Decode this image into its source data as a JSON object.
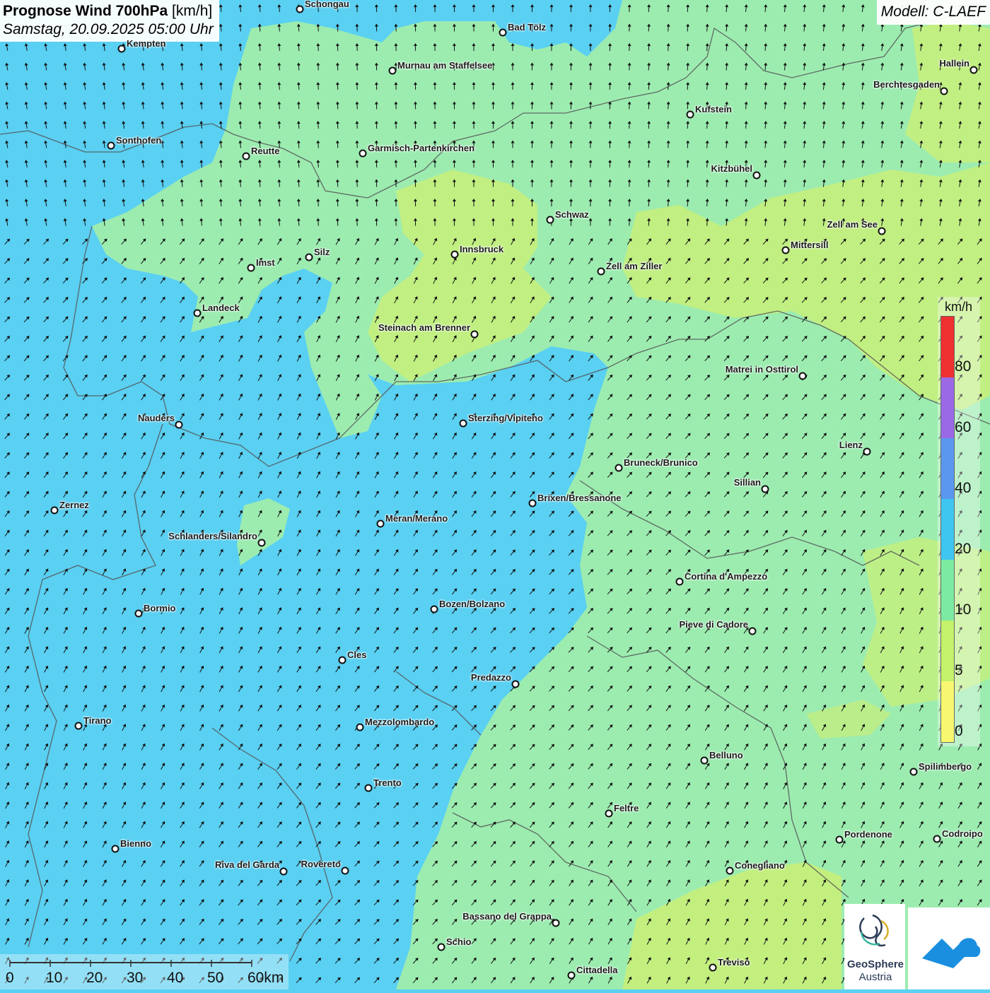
{
  "title": {
    "bold": "Prognose Wind 700hPa",
    "unit": "[km/h]",
    "datetime": "Samstag, 20.09.2025 05:00 Uhr"
  },
  "model": "Modell: C-LAEF",
  "legend": {
    "unit": "km/h",
    "ticks": [
      "80",
      "60",
      "40",
      "20",
      "10",
      "5",
      "0"
    ],
    "colors": [
      "#ee3030",
      "#9a6ae6",
      "#5a98ef",
      "#3ec6f0",
      "#7deaa2",
      "#c4f26a",
      "#f8f870"
    ]
  },
  "scale": {
    "labels": [
      "0",
      "10",
      "20",
      "30",
      "40",
      "50",
      "60km"
    ]
  },
  "logo": {
    "name": "GeoSphere",
    "subtitle": "Austria"
  },
  "map_colors": {
    "strong_20_40": "#5ad0f2",
    "mid_10_20": "#9cecb0",
    "weak_5_10": "#c8f07a",
    "border": "#555555"
  },
  "cities": [
    {
      "name": "Schongau"
    },
    {
      "name": "Bad Tölz"
    },
    {
      "name": "Kempten"
    },
    {
      "name": "Murnau am Staffelsee"
    },
    {
      "name": "Hallein"
    },
    {
      "name": "Berchtesgaden"
    },
    {
      "name": "Kufstein"
    },
    {
      "name": "Sonthofen"
    },
    {
      "name": "Reutte"
    },
    {
      "name": "Garmisch-Partenkirchen"
    },
    {
      "name": "Kitzbühel"
    },
    {
      "name": "Schwaz"
    },
    {
      "name": "Zell am See"
    },
    {
      "name": "Mittersill"
    },
    {
      "name": "Innsbruck"
    },
    {
      "name": "Silz"
    },
    {
      "name": "Imst"
    },
    {
      "name": "Zell am Ziller"
    },
    {
      "name": "Landeck"
    },
    {
      "name": "Steinach am Brenner"
    },
    {
      "name": "Matrei in Osttirol"
    },
    {
      "name": "Nauders"
    },
    {
      "name": "Sterzing/Vipiteno"
    },
    {
      "name": "Lienz"
    },
    {
      "name": "Bruneck/Brunico"
    },
    {
      "name": "Sillian"
    },
    {
      "name": "Brixen/Bressanone"
    },
    {
      "name": "Zernez"
    },
    {
      "name": "Meran/Merano"
    },
    {
      "name": "Schlanders/Silandro"
    },
    {
      "name": "Cortina d'Ampezzo"
    },
    {
      "name": "Bozen/Bolzano"
    },
    {
      "name": "Bormio"
    },
    {
      "name": "Pieve di Cadore"
    },
    {
      "name": "Cles"
    },
    {
      "name": "Predazzo"
    },
    {
      "name": "Tirano"
    },
    {
      "name": "Mezzolombardo"
    },
    {
      "name": "Belluno"
    },
    {
      "name": "Spilimbergo"
    },
    {
      "name": "Trento"
    },
    {
      "name": "Feltre"
    },
    {
      "name": "Pordenone"
    },
    {
      "name": "Codroipo"
    },
    {
      "name": "Bienno"
    },
    {
      "name": "Riva del Garda"
    },
    {
      "name": "Rovereto"
    },
    {
      "name": "Conegliano"
    },
    {
      "name": "Bassano del Grappa"
    },
    {
      "name": "Schio"
    },
    {
      "name": "Treviso"
    },
    {
      "name": "Cittadella"
    }
  ]
}
